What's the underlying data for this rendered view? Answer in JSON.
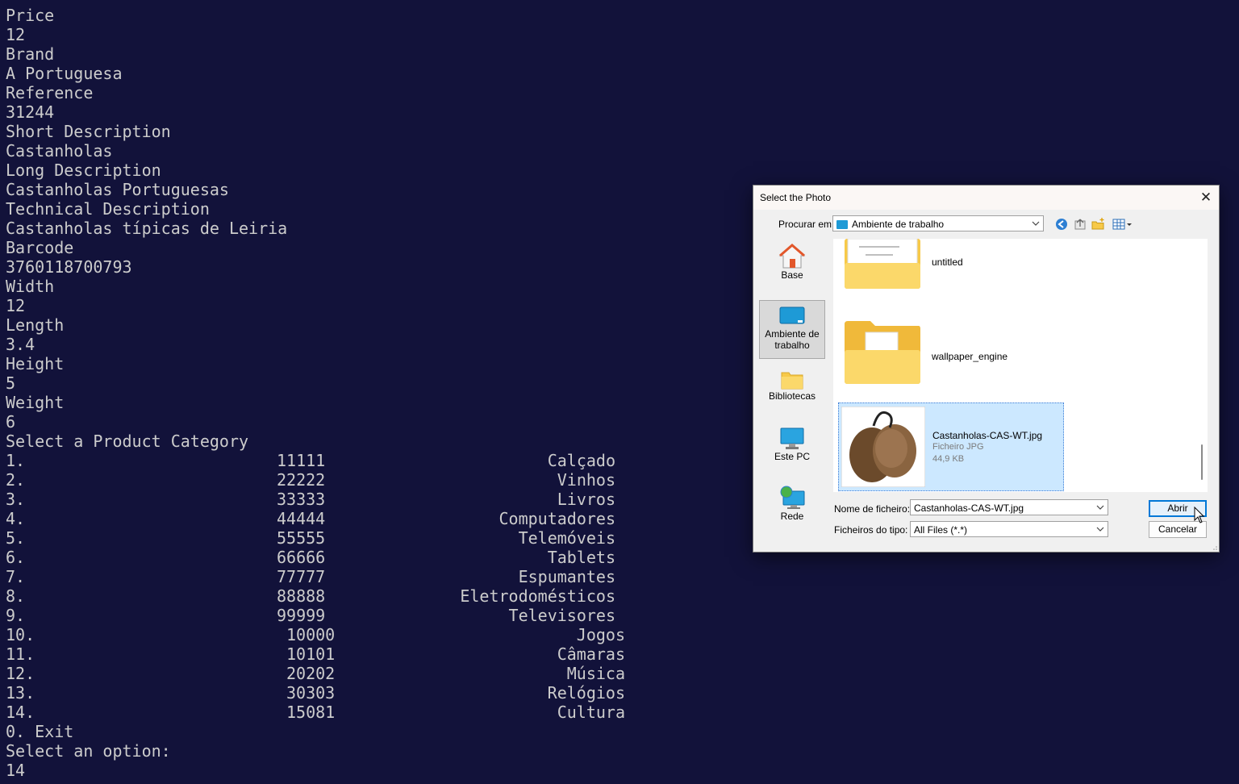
{
  "terminal": {
    "lines": [
      "Price",
      "12",
      "Brand",
      "A Portuguesa",
      "Reference",
      "31244",
      "Short Description",
      "Castanholas",
      "Long Description",
      "Castanholas Portuguesas",
      "Technical Description",
      "Castanholas típicas de Leiria",
      "Barcode",
      "3760118700793",
      "Width",
      "12",
      "Length",
      "3.4",
      "Height",
      "5",
      "Weight",
      "6",
      "Select a Product Category"
    ],
    "categories": [
      {
        "num": "1.",
        "code": "11111",
        "name": "Calçado"
      },
      {
        "num": "2.",
        "code": "22222",
        "name": "Vinhos"
      },
      {
        "num": "3.",
        "code": "33333",
        "name": "Livros"
      },
      {
        "num": "4.",
        "code": "44444",
        "name": "Computadores"
      },
      {
        "num": "5.",
        "code": "55555",
        "name": "Telemóveis"
      },
      {
        "num": "6.",
        "code": "66666",
        "name": "Tablets"
      },
      {
        "num": "7.",
        "code": "77777",
        "name": "Espumantes"
      },
      {
        "num": "8.",
        "code": "88888",
        "name": "Eletrodomésticos"
      },
      {
        "num": "9.",
        "code": "99999",
        "name": "Televisores"
      },
      {
        "num": "10.",
        "code": "10000",
        "name": "Jogos"
      },
      {
        "num": "11.",
        "code": "10101",
        "name": "Câmaras"
      },
      {
        "num": "12.",
        "code": "20202",
        "name": "Música"
      },
      {
        "num": "13.",
        "code": "30303",
        "name": "Relógios"
      },
      {
        "num": "14.",
        "code": "15081",
        "name": "Cultura"
      }
    ],
    "footer": [
      "0. Exit",
      "Select an option:",
      "14"
    ]
  },
  "dialog": {
    "title": "Select the Photo",
    "close_glyph": "✕",
    "look_in_label": "Procurar em:",
    "look_in_value": "Ambiente de trabalho",
    "toolbar_icons": [
      "back-icon",
      "up-folder-icon",
      "new-folder-icon",
      "view-menu-icon"
    ],
    "places": [
      {
        "label": "Base",
        "icon": "home-icon"
      },
      {
        "label": "Ambiente de trabalho",
        "icon": "desktop-icon"
      },
      {
        "label": "Bibliotecas",
        "icon": "libraries-icon"
      },
      {
        "label": "Este PC",
        "icon": "computer-icon"
      },
      {
        "label": "Rede",
        "icon": "network-icon"
      }
    ],
    "files": [
      {
        "name": "untitled",
        "icon": "folder-icon"
      },
      {
        "name": "wallpaper_engine",
        "icon": "folder-icon"
      },
      {
        "name": "Castanholas-CAS-WT.jpg",
        "type": "Ficheiro JPG",
        "size": "44,9 KB",
        "icon": "castanets-thumbnail"
      }
    ],
    "file_name_label": "Nome de ficheiro:",
    "file_name_value": "Castanholas-CAS-WT.jpg",
    "file_type_label": "Ficheiros do tipo:",
    "file_type_value": "All Files (*.*)",
    "open_button": "Abrir",
    "cancel_button": "Cancelar",
    "colors": {
      "terminal_bg": "#12123a",
      "selection": "#cce8ff",
      "accent": "#0078d7",
      "folder": "#f7c948"
    }
  }
}
